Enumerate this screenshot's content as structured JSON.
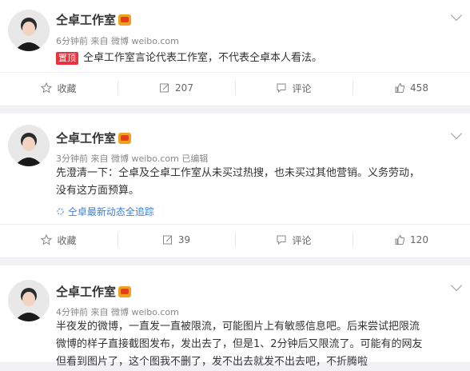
{
  "posts": [
    {
      "name": "仝卓工作室",
      "meta": "6分钟前 来自 微博 weibo.com",
      "badge": "置顶",
      "text": "仝卓工作室言论代表工作室，不代表仝卓本人看法。",
      "actions": {
        "favorite": "收藏",
        "repost": "207",
        "comment": "评论",
        "like": "458"
      }
    },
    {
      "name": "仝卓工作室",
      "meta": "3分钟前 来自 微博 weibo.com  已编辑",
      "text_line1": "先澄清一下：仝卓及仝卓工作室从未买过热搜，也未买过其他营销。义务劳动，",
      "text_line2": "没有这方面预算。",
      "link": "仝卓最新动态全追踪",
      "actions": {
        "favorite": "收藏",
        "repost": "39",
        "comment": "评论",
        "like": "120"
      }
    },
    {
      "name": "仝卓工作室",
      "meta": "4分钟前 来自 微博 weibo.com",
      "text_line1": "半夜发的微博，一直发一直被限流，可能图片上有敏感信息吧。后来尝试把限流",
      "text_line2": "微博的样子直接截图发布，发出去了，但是1、2分钟后又限流了。可能有的网友",
      "text_line3": "但看到图片了，这个图我不删了，发不出去就发不出去吧，不折腾啦"
    }
  ],
  "icons": [
    "star-icon",
    "repost-icon",
    "comment-icon",
    "like-icon",
    "chevron-down-icon",
    "refresh-icon"
  ],
  "colors": {
    "link": "#3a7fd5",
    "badge": "#e8323e",
    "text": "#333333",
    "meta": "#888888"
  }
}
